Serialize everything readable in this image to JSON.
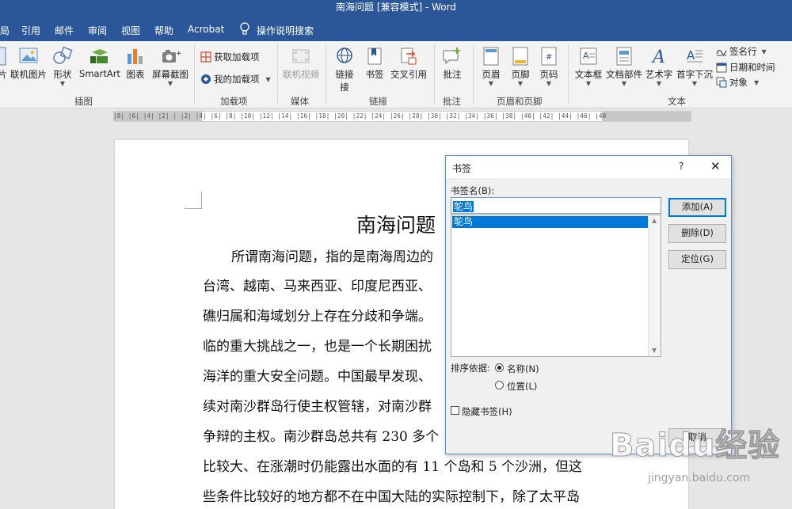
{
  "window": {
    "title": "南海问题 [兼容模式] - Word"
  },
  "menu": {
    "tabs": [
      "局",
      "引用",
      "邮件",
      "审阅",
      "视图",
      "帮助",
      "Acrobat"
    ],
    "tell_me": "操作说明搜索"
  },
  "ribbon": {
    "illustrations": {
      "partial_label": "片",
      "online_pictures": "联机图片",
      "shapes": "形状",
      "smartart": "SmartArt",
      "chart": "图表",
      "screenshot": "屏幕截图",
      "group": "插图"
    },
    "addins": {
      "get_addins": "获取加载项",
      "my_addins": "我的加载项",
      "group": "加载项"
    },
    "media": {
      "online_video": "联机视频",
      "group": "媒体"
    },
    "links": {
      "link": "链接",
      "link2": "接",
      "bookmark": "书签",
      "cross_ref": "交叉引用",
      "group": "链接"
    },
    "comments": {
      "comment": "批注",
      "group": "批注"
    },
    "header_footer": {
      "header": "页眉",
      "footer": "页脚",
      "page_number": "页码",
      "group": "页眉和页脚"
    },
    "text": {
      "textbox": "文本框",
      "quick_parts": "文档部件",
      "wordart": "艺术字",
      "drop_cap": "首字下沉",
      "signature_line": "签名行",
      "date_time": "日期和时间",
      "object": "对象",
      "group": "文本"
    }
  },
  "ruler": {
    "ticks": "|8|  |6|  |4|  |2|  |  |2|  |4|  |6|  |8|  |10|  |12|  |14|  |16|  |18|  |20|  |22|  |24|  |26|  |28|  |30|  |32|  |34|  |36|  |38|  |40|  |42|  |44|  |46|  |48"
  },
  "document": {
    "title": "南海问题",
    "lines": [
      "所谓南海问题，指的是南海周边的",
      "台湾、越南、马来西亚、印度尼西亚、",
      "礁归属和海域划分上存在分歧和争端。",
      "临的重大挑战之一，也是一个长期困扰",
      "海洋的重大安全问题。中国最早发现、",
      "续对南沙群岛行使主权管辖，对南沙群",
      "争辩的主权。南沙群岛总共有 230 多个",
      "比较大、在涨潮时仍能露出水面的有 11 个岛和 5 个沙洲，但这",
      "些条件比较好的地方都不在中国大陆的实际控制下，除了太平岛"
    ]
  },
  "dialog": {
    "title": "书签",
    "help": "?",
    "close": "✕",
    "name_label": "书签名(B):",
    "name_value": "鸵鸟",
    "list_items": [
      "鸵鸟"
    ],
    "buttons": {
      "add": "添加(A)",
      "delete": "删除(D)",
      "goto": "定位(G)",
      "cancel": "取消"
    },
    "sort_label": "排序依据:",
    "sort_options": {
      "by_name": "名称(N)",
      "by_location": "位置(L)"
    },
    "sort_selected": "名称(N)",
    "hidden_label": "隐藏书签(H)",
    "hidden_checked": false
  },
  "watermark": {
    "brand": "Baidu经验",
    "url": "jingyan.baidu.com"
  }
}
